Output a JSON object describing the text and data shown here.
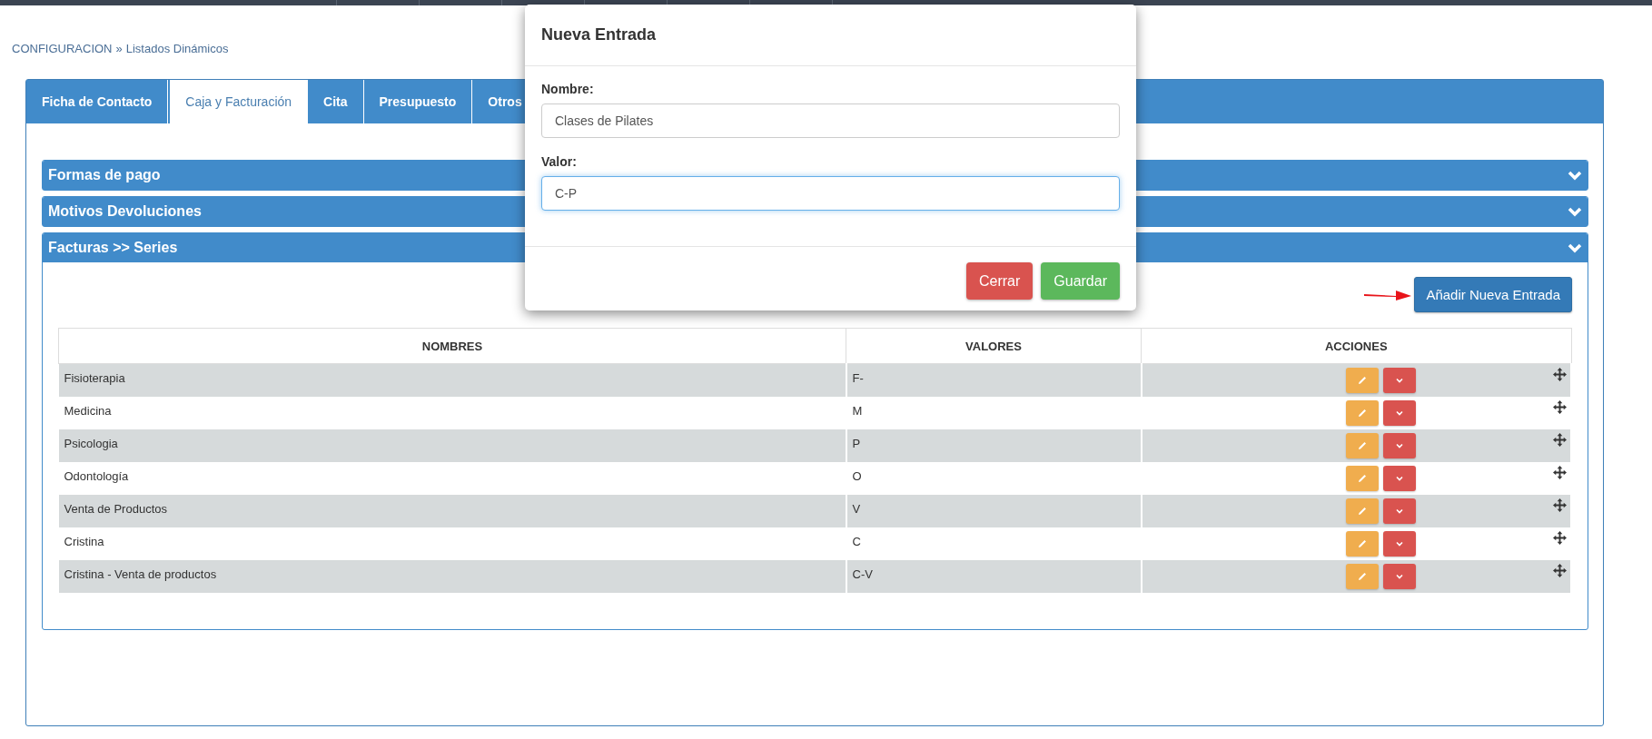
{
  "breadcrumb": {
    "section": "CONFIGURACION",
    "separator": "»",
    "page": "Listados Dinámicos"
  },
  "tabs": [
    {
      "label": "Ficha de Contacto",
      "selected": false
    },
    {
      "label": "Caja y Facturación",
      "selected": true
    },
    {
      "label": "Cita",
      "selected": false
    },
    {
      "label": "Presupuesto",
      "selected": false
    },
    {
      "label": "Otros",
      "selected": false
    }
  ],
  "panels": [
    {
      "title": "Formas de pago",
      "expanded": false
    },
    {
      "title": "Motivos Devoluciones",
      "expanded": false
    },
    {
      "title": "Facturas >> Series",
      "expanded": true,
      "add_button": "Añadir Nueva Entrada",
      "table": {
        "columns": [
          "NOMBRES",
          "VALORES",
          "ACCIONES"
        ],
        "rows": [
          {
            "name": "Fisioterapia",
            "value": "F-"
          },
          {
            "name": "Medicina",
            "value": "M"
          },
          {
            "name": "Psicologia",
            "value": "P"
          },
          {
            "name": "Odontología",
            "value": "O"
          },
          {
            "name": "Venta de Productos",
            "value": "V"
          },
          {
            "name": "Cristina",
            "value": "C"
          },
          {
            "name": "Cristina - Venta de productos",
            "value": "C-V"
          }
        ]
      }
    }
  ],
  "modal": {
    "title": "Nueva Entrada",
    "fields": [
      {
        "label": "Nombre:",
        "value": "Clases de Pilates",
        "focused": false
      },
      {
        "label": "Valor:",
        "value": "C-P",
        "focused": true
      }
    ],
    "buttons": [
      {
        "label": "Cerrar",
        "kind": "danger"
      },
      {
        "label": "Guardar",
        "kind": "success"
      }
    ]
  }
}
